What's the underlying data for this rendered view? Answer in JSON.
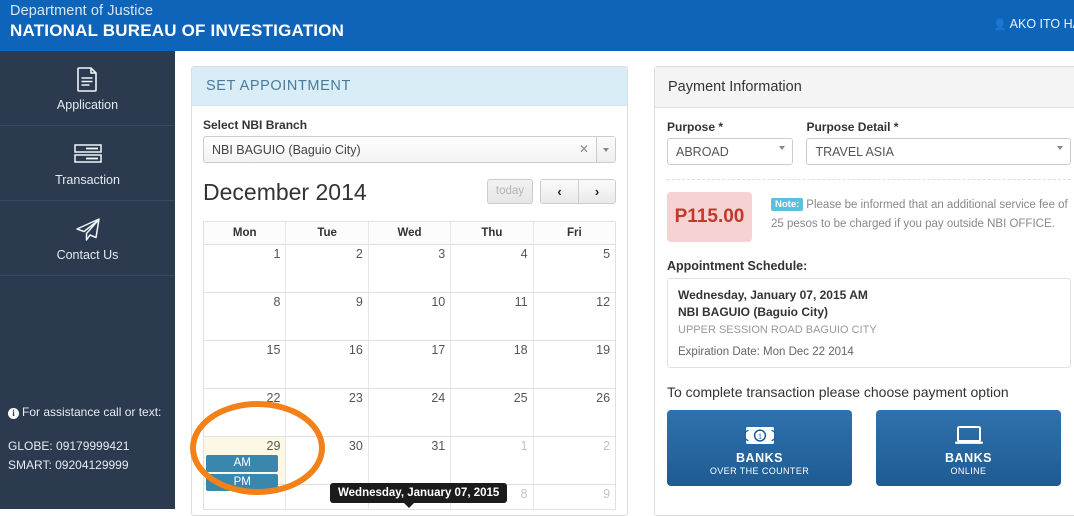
{
  "header": {
    "department": "Department of Justice",
    "bureau": "NATIONAL BUREAU OF INVESTIGATION",
    "user_label": "AKO ITO HA",
    "user_icon": "user-icon",
    "brand_color": "#0e64b8"
  },
  "sidebar": {
    "items": [
      {
        "label": "Application",
        "icon": "document-icon"
      },
      {
        "label": "Transaction",
        "icon": "list-rows-icon"
      },
      {
        "label": "Contact Us",
        "icon": "paper-plane-icon"
      }
    ],
    "assistance": {
      "icon": "info-circle-icon",
      "title": "For assistance call or text:",
      "globe": "GLOBE: 09179999421",
      "smart": "SMART: 09204129999"
    },
    "bg_color": "#2b3a4f"
  },
  "appointment_panel": {
    "title": "SET APPOINTMENT",
    "branch_label": "Select NBI Branch",
    "branch_value": "NBI BAGUIO (Baguio City)",
    "clear_icon": "clear-x-icon",
    "dropdown_icon": "chevron-down-icon",
    "calendar": {
      "title": "December 2014",
      "today_button": "today",
      "prev_icon": "chevron-left-icon",
      "next_icon": "chevron-right-icon",
      "weekdays": [
        "Mon",
        "Tue",
        "Wed",
        "Thu",
        "Fri"
      ],
      "weeks": [
        [
          {
            "day": "1",
            "other": false
          },
          {
            "day": "2",
            "other": false
          },
          {
            "day": "3",
            "other": false
          },
          {
            "day": "4",
            "other": false
          },
          {
            "day": "5",
            "other": false
          }
        ],
        [
          {
            "day": "8",
            "other": false
          },
          {
            "day": "9",
            "other": false
          },
          {
            "day": "10",
            "other": false
          },
          {
            "day": "11",
            "other": false
          },
          {
            "day": "12",
            "other": false
          }
        ],
        [
          {
            "day": "15",
            "other": false
          },
          {
            "day": "16",
            "other": false
          },
          {
            "day": "17",
            "other": false
          },
          {
            "day": "18",
            "other": false
          },
          {
            "day": "19",
            "other": false
          }
        ],
        [
          {
            "day": "22",
            "other": false
          },
          {
            "day": "23",
            "other": false
          },
          {
            "day": "24",
            "other": false
          },
          {
            "day": "25",
            "other": false
          },
          {
            "day": "26",
            "other": false
          }
        ],
        [
          {
            "day": "29",
            "other": false,
            "today": true,
            "slots": [
              "AM",
              "PM"
            ]
          },
          {
            "day": "30",
            "other": false
          },
          {
            "day": "31",
            "other": false
          },
          {
            "day": "1",
            "other": true
          },
          {
            "day": "2",
            "other": true
          }
        ],
        [
          {
            "day": "",
            "other": true
          },
          {
            "day": "",
            "other": true
          },
          {
            "day": "",
            "other": true
          },
          {
            "day": "8",
            "other": true
          },
          {
            "day": "9",
            "other": true
          }
        ]
      ],
      "tooltip": "Wednesday, January 07, 2015",
      "highlight_color": "#f28119",
      "slot_color": "#3a87ad",
      "today_cell_color": "#fcf8e3"
    }
  },
  "payment_panel": {
    "title": "Payment Information",
    "purpose_label": "Purpose *",
    "purpose_value": "ABROAD",
    "detail_label": "Purpose Detail *",
    "detail_value": "TRAVEL ASIA",
    "fee_amount": "P115.00",
    "fee_color": "#c0392b",
    "note_badge": "Note:",
    "note_text": "Please be informed that an additional service fee of 25 pesos to be charged if you pay outside NBI OFFICE.",
    "schedule_label": "Appointment Schedule:",
    "schedule": {
      "datetime": "Wednesday, January 07, 2015 AM",
      "branch": "NBI BAGUIO (Baguio City)",
      "address": "UPPER SESSION ROAD BAGUIO CITY",
      "expiration": "Expiration Date: Mon Dec 22 2014"
    },
    "choose_text": "To complete transaction please choose payment option",
    "options": [
      {
        "line1": "BANKS",
        "line2": "OVER THE COUNTER",
        "icon": "banknote-icon"
      },
      {
        "line1": "BANKS",
        "line2": "ONLINE",
        "icon": "laptop-icon"
      }
    ],
    "option_color": "#2f72ad"
  }
}
